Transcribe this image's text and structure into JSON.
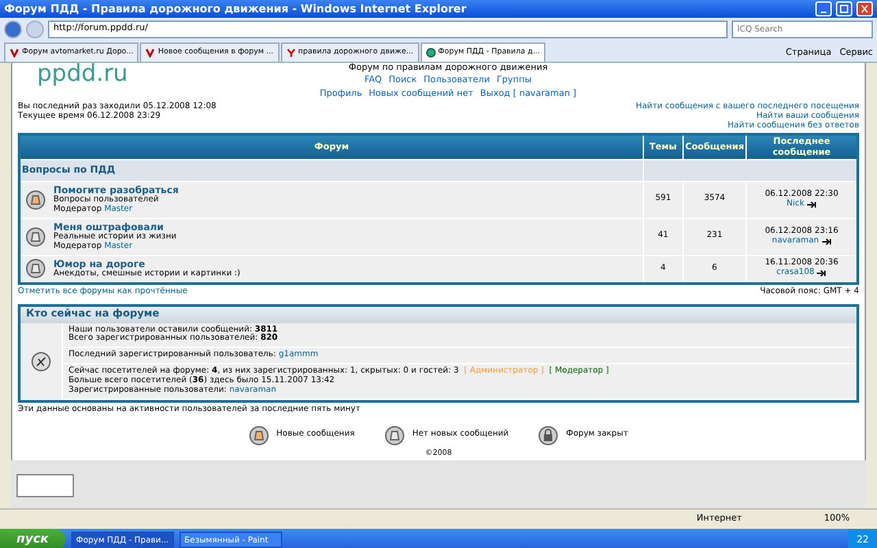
{
  "window": {
    "title": "Форум ПДД - Правила дорожного движения - Windows Internet Explorer"
  },
  "address_bar": {
    "url": "http://forum.ppdd.ru/",
    "search_placeholder": "ICQ Search"
  },
  "tabs": [
    {
      "label": "Форум avtomarket.ru Доро...",
      "kind": "v",
      "selected": false
    },
    {
      "label": "Новое сообщения в форум ...",
      "kind": "v",
      "selected": false
    },
    {
      "label": "правила дорожного движе...",
      "kind": "yandex",
      "selected": false
    },
    {
      "label": "Форум ПДД - Правила д...",
      "kind": "browser",
      "selected": true
    }
  ],
  "command_bar": {
    "page": "Страница",
    "tools": "Сервис"
  },
  "header": {
    "logo": "ppdd.ru",
    "subtitle": "Форум по правилам дорожного движения",
    "nav_row_1": [
      "FAQ",
      "Поиск",
      "Пользователи",
      "Группы"
    ],
    "nav_row_2": [
      "Профиль",
      "Новых сообщений нет",
      "Выход [ navaraman ]"
    ]
  },
  "visit_info": [
    "Вы последний раз заходили 05.12.2008 12:08",
    "Текущее время 06.12.2008 23:29"
  ],
  "search_links": [
    "Найти сообщения с вашего последнего посещения",
    "Найти ваши сообщения",
    "Найти сообщения без ответов"
  ],
  "table": {
    "columns": [
      "Форум",
      "Темы",
      "Сообщения",
      "Последнее сообщение"
    ],
    "category": "Вопросы по ПДД",
    "rows": [
      {
        "title": "Помогите разобраться",
        "description": "Вопросы пользователей",
        "moderator_label": "Модератор",
        "moderator": "Master",
        "topics": "591",
        "posts": "3574",
        "last_date": "06.12.2008 22:30",
        "last_user": "Nick",
        "kind": "new"
      },
      {
        "title": "Меня оштрафовали",
        "description": "Реальные истории из жизни",
        "moderator_label": "Модератор",
        "moderator": "Master",
        "topics": "41",
        "posts": "231",
        "last_date": "06.12.2008 23:16",
        "last_user": "navaraman",
        "kind": "none"
      },
      {
        "title": "Юмор на дороге",
        "description": "Анекдоты, смешные истории и картинки :)",
        "topics": "4",
        "posts": "6",
        "last_date": "16.11.2008 20:36",
        "last_user": "crasa108",
        "kind": "none"
      }
    ]
  },
  "mark_read": "Отметить все форумы как прочтённые",
  "timezone": "Часовой пояс: GMT + 4",
  "online": {
    "title": "Кто сейчас на форуме",
    "stats": [
      "Наши пользователи оставили сообщений: **3811**",
      "Всего зарегистрированных пользователей: **820**"
    ],
    "last_user_label": "Последний зарегистрированный пользователь:",
    "last_user": "g1ammm",
    "now": "Сейчас посетителей на форуме: **4**, из них зарегистрированных: 1, скрытых: 0 и гостей: 3",
    "admin": "[ Администратор ]",
    "mod": "[ Модератор ]",
    "record": "Больше всего посетителей (**36**) здесь было 15.11.2007 13:42",
    "registered_label": "Зарегистрированные пользователи:",
    "registered_user": "navaraman"
  },
  "activity_note": "Эти данные основаны на активности пользователей за последние пять минут",
  "legend": [
    {
      "label": "Новые сообщения",
      "kind": "new"
    },
    {
      "label": "Нет новых сообщений",
      "kind": "none"
    },
    {
      "label": "Форум закрыт",
      "kind": "locked"
    }
  ],
  "copyright": "©2008",
  "status_bar": {
    "zone": "Интернет",
    "zoom": "100%"
  },
  "taskbar": {
    "start": "пуск",
    "tasks": [
      {
        "label": "Форум ПДД - Прави...",
        "selected": true
      },
      {
        "label": "Безымянный - Paint",
        "selected": false
      }
    ],
    "clock": "22"
  }
}
